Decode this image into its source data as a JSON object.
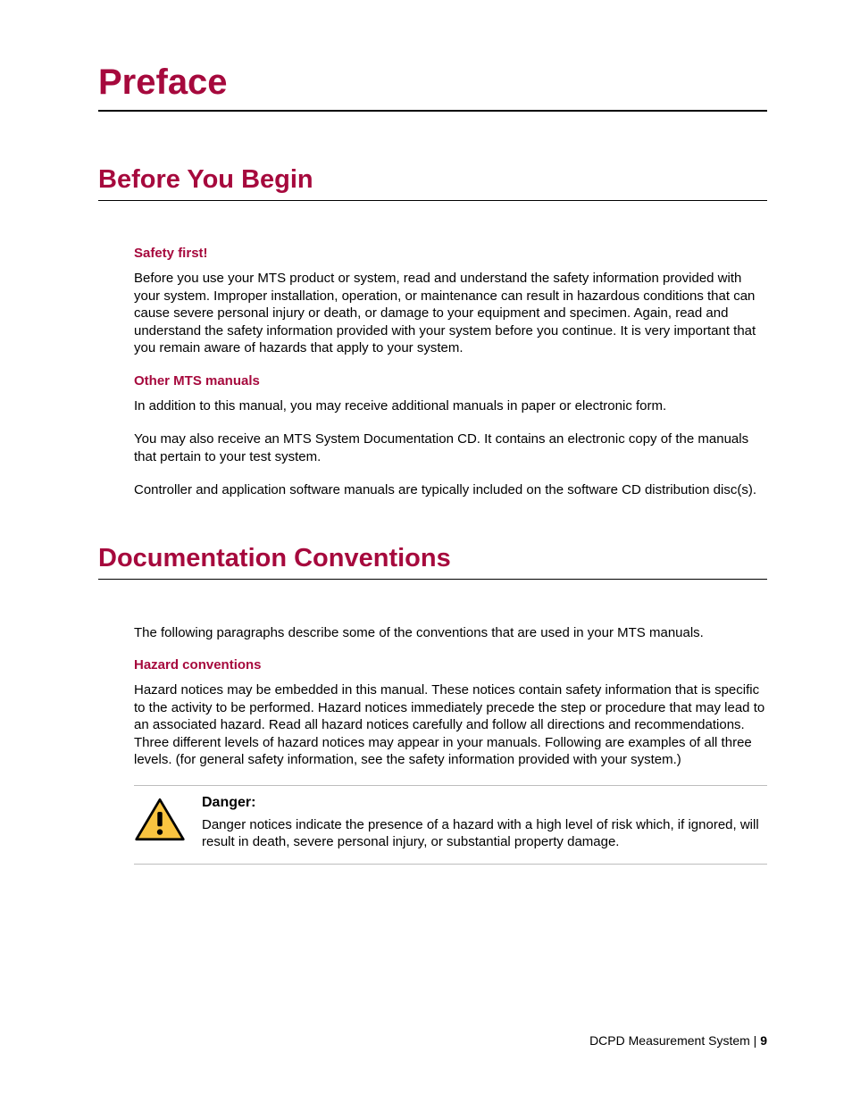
{
  "h1": "Preface",
  "sections": [
    {
      "title": "Before You Begin",
      "blocks": [
        {
          "subhead": "Safety first!",
          "paras": [
            "Before you use your MTS product or system, read and understand the safety information provided with your system. Improper installation, operation, or maintenance can result in hazardous conditions that can cause severe personal injury or death, or damage to your equipment and specimen. Again, read and understand the safety information provided with your system before you continue. It is very important that you remain aware of hazards that apply to your system."
          ]
        },
        {
          "subhead": "Other MTS manuals",
          "paras": [
            "In addition to this manual, you may receive additional manuals in paper or electronic form.",
            "You may also receive an MTS System Documentation CD. It contains an electronic copy of the manuals that pertain to your test system.",
            "Controller and application software manuals are typically included on the software CD distribution disc(s)."
          ]
        }
      ]
    },
    {
      "title": "Documentation Conventions",
      "blocks": [
        {
          "subhead": null,
          "paras": [
            "The following paragraphs describe some of the conventions that are used in your MTS manuals."
          ]
        },
        {
          "subhead": "Hazard conventions",
          "paras": [
            "Hazard notices may be embedded in this manual. These notices contain safety information that is specific to the activity to be performed. Hazard notices immediately precede the step or procedure that may lead to an associated hazard. Read all hazard notices carefully and follow all directions and recommendations. Three different levels of hazard notices may appear in your manuals. Following are examples of all three levels. (for general safety information, see the safety information provided with your system.)"
          ]
        }
      ]
    }
  ],
  "callout": {
    "title": "Danger:",
    "text": "Danger notices indicate the presence of a hazard with a high level of risk which, if ignored, will result in death, severe personal injury, or substantial property damage."
  },
  "footer": {
    "doc": "DCPD Measurement System",
    "sep": " | ",
    "page": "9"
  }
}
